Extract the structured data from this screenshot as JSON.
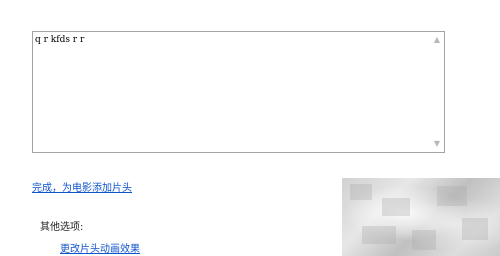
{
  "editor": {
    "text": "q r kfds r r",
    "scroll_up_icon": "▲",
    "scroll_down_icon": "▼"
  },
  "links": {
    "done": "完成，为电影添加片头",
    "change_animation": "更改片头动画效果"
  },
  "other_options": {
    "label": "其他选项:"
  },
  "overlay": {
    "description_icon": "blurred-region"
  }
}
